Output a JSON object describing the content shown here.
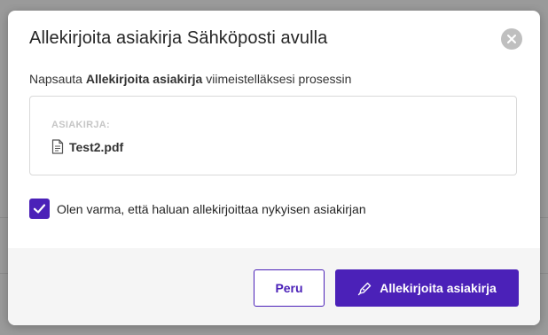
{
  "modal": {
    "title": "Allekirjoita asiakirja Sähköposti avulla",
    "instruction_prefix": "Napsauta ",
    "instruction_bold": "Allekirjoita asiakirja",
    "instruction_suffix": " viimeistelläksesi prosessin",
    "close_icon": "close-icon"
  },
  "document": {
    "label": "ASIAKIRJA:",
    "file_name": "Test2.pdf",
    "file_icon": "document-icon"
  },
  "confirmation": {
    "checked": true,
    "label": "Olen varma, että haluan allekirjoittaa nykyisen asiakirjan"
  },
  "footer": {
    "cancel_label": "Peru",
    "sign_label": "Allekirjoita asiakirja",
    "sign_icon": "pen-icon"
  },
  "colors": {
    "accent": "#4b21b8",
    "overlay": "#9a9a9a",
    "footer_bg": "#f5f5f5"
  }
}
